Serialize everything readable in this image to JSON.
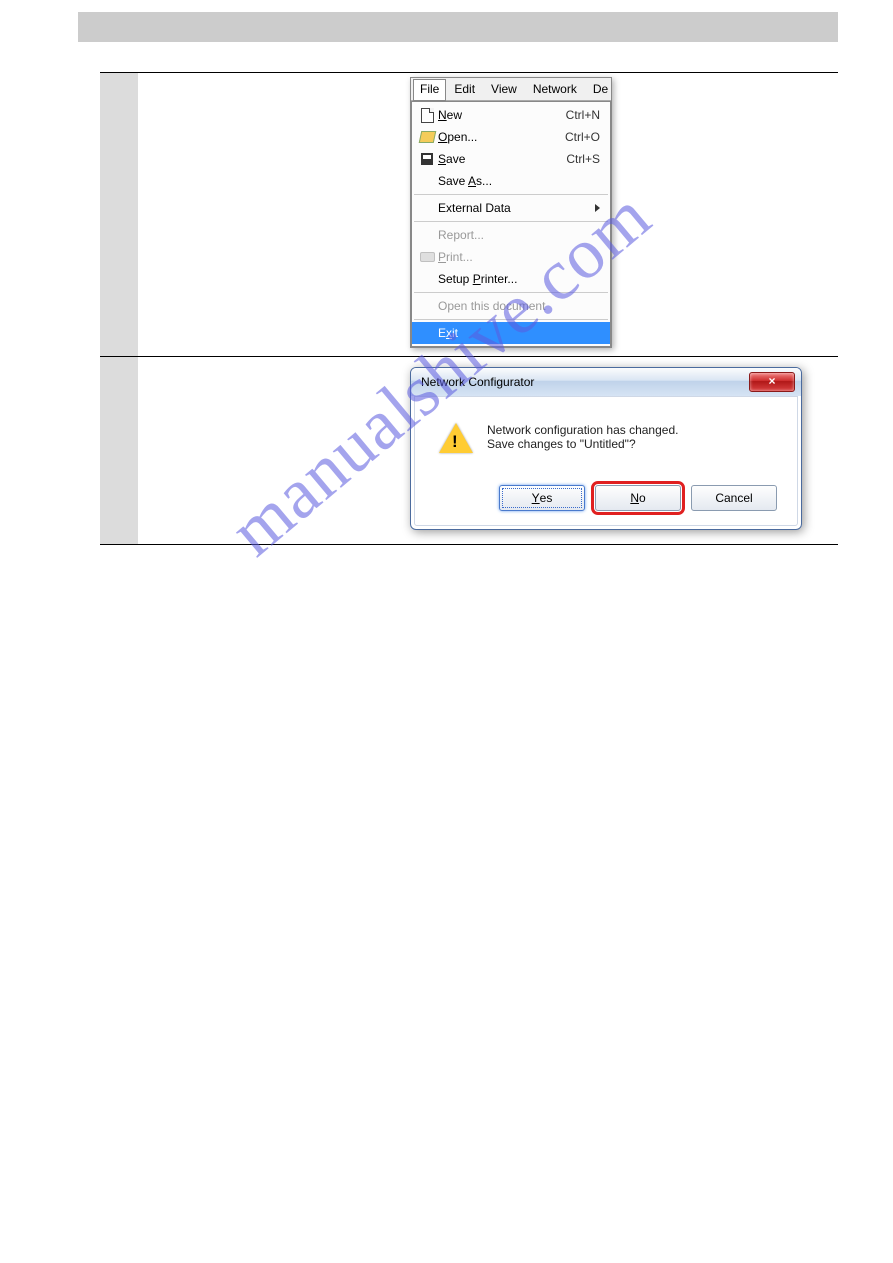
{
  "watermark": "manualshive.com",
  "menubar": {
    "items": [
      "File",
      "Edit",
      "View",
      "Network",
      "De"
    ],
    "active_index": 0
  },
  "file_menu": {
    "items": [
      {
        "label": "New",
        "underline": "N",
        "shortcut": "Ctrl+N",
        "icon": "new"
      },
      {
        "label": "Open...",
        "underline": "O",
        "shortcut": "Ctrl+O",
        "icon": "open"
      },
      {
        "label": "Save",
        "underline": "S",
        "shortcut": "Ctrl+S",
        "icon": "save"
      },
      {
        "label": "Save As...",
        "underline": "A",
        "shortcut": ""
      }
    ],
    "external": {
      "label": "External Data",
      "has_submenu": true
    },
    "report": {
      "label": "Report...",
      "disabled": true
    },
    "print": {
      "label": "Print...",
      "underline": "P",
      "disabled": true,
      "icon": "print"
    },
    "setup_printer": {
      "label": "Setup Printer...",
      "underline": "P"
    },
    "open_doc": {
      "label": "Open this document",
      "disabled": true
    },
    "exit": {
      "label": "Exit",
      "underline": "x",
      "highlighted": true
    }
  },
  "dialog": {
    "title": "Network Configurator",
    "msg_line1": "Network configuration has changed.",
    "msg_line2": "Save changes to \"Untitled\"?",
    "btn_yes": "Yes",
    "btn_no": "No",
    "btn_cancel": "Cancel",
    "close_glyph": "×",
    "highlighted_button": "No",
    "focused_button": "Yes"
  }
}
